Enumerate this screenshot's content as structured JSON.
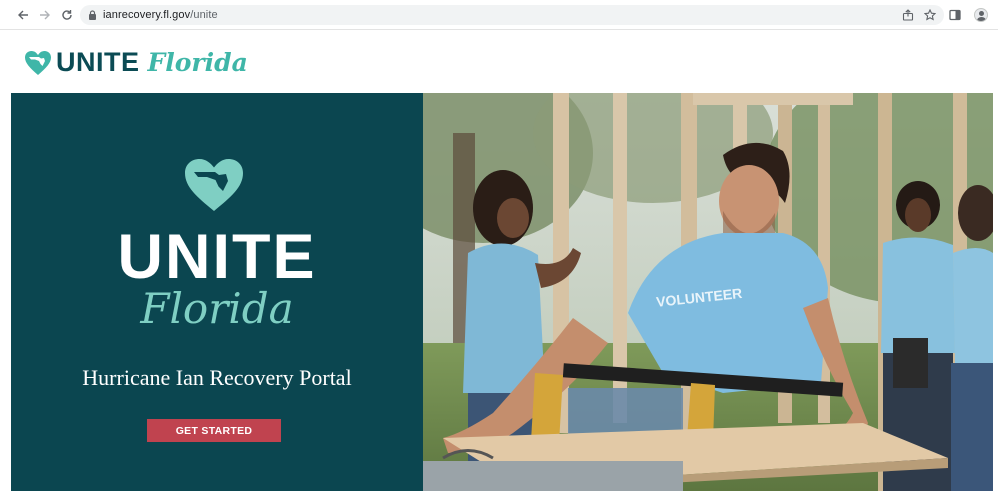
{
  "browser": {
    "url_domain": "ianrecovery.fl.gov",
    "url_path": "/unite",
    "icons": [
      "back-icon",
      "forward-icon",
      "reload-icon",
      "lock-icon",
      "share-icon",
      "star-icon",
      "side-panel-icon",
      "profile-icon"
    ]
  },
  "header": {
    "logo_unite": "UNITE",
    "logo_florida": "Florida"
  },
  "hero": {
    "unite": "UNITE",
    "florida": "Florida",
    "tagline": "Hurricane Ian Recovery Portal",
    "cta_label": "GET STARTED",
    "photo_shirt_text": "VOLUNTEER"
  },
  "colors": {
    "brand_dark": "#0b4650",
    "brand_teal": "#3fb6a8",
    "brand_light_teal": "#7fcfc3",
    "cta_red": "#c0434f"
  }
}
